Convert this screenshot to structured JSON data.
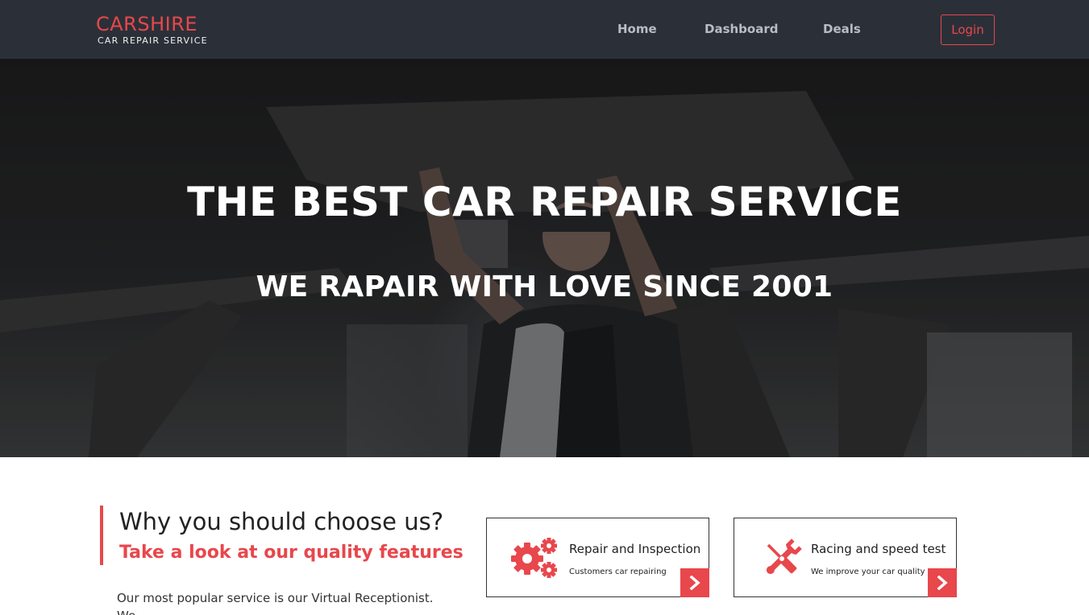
{
  "brand": {
    "name": "CARSHIRE",
    "tagline": "CAR REPAIR SERVICE"
  },
  "nav": {
    "home": "Home",
    "dashboard": "Dashboard",
    "deals": "Deals",
    "login": "Login"
  },
  "hero": {
    "title": "THE BEST CAR REPAIR SERVICE",
    "subtitle": "WE RAPAIR WITH LOVE SINCE 2001"
  },
  "why": {
    "title": "Why you should choose us?",
    "subtitle": "Take a look at our quality features",
    "text": "Our most popular service is our Virtual Receptionist. We"
  },
  "features": [
    {
      "title": "Repair and Inspection",
      "description": "Customers car repairing",
      "icon": "gears-icon"
    },
    {
      "title": "Racing and speed test",
      "description": "We improve your car quality",
      "icon": "wrench-screwdriver-icon"
    }
  ],
  "colors": {
    "accent": "#e8474c",
    "navbar": "#2b3038",
    "nav_text": "#b9bcc2"
  }
}
